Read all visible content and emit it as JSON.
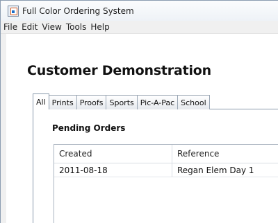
{
  "window": {
    "title": "Full Color Ordering System"
  },
  "menu": [
    "File",
    "Edit",
    "View",
    "Tools",
    "Help"
  ],
  "page": {
    "heading": "Customer Demonstration"
  },
  "tabs": [
    "All",
    "Prints",
    "Proofs",
    "Sports",
    "Pic-A-Pac",
    "School"
  ],
  "section": {
    "title": "Pending Orders"
  },
  "table": {
    "columns": [
      "Created",
      "Reference"
    ],
    "rows": [
      [
        "2011-08-18",
        "Regan Elem Day 1"
      ]
    ]
  }
}
